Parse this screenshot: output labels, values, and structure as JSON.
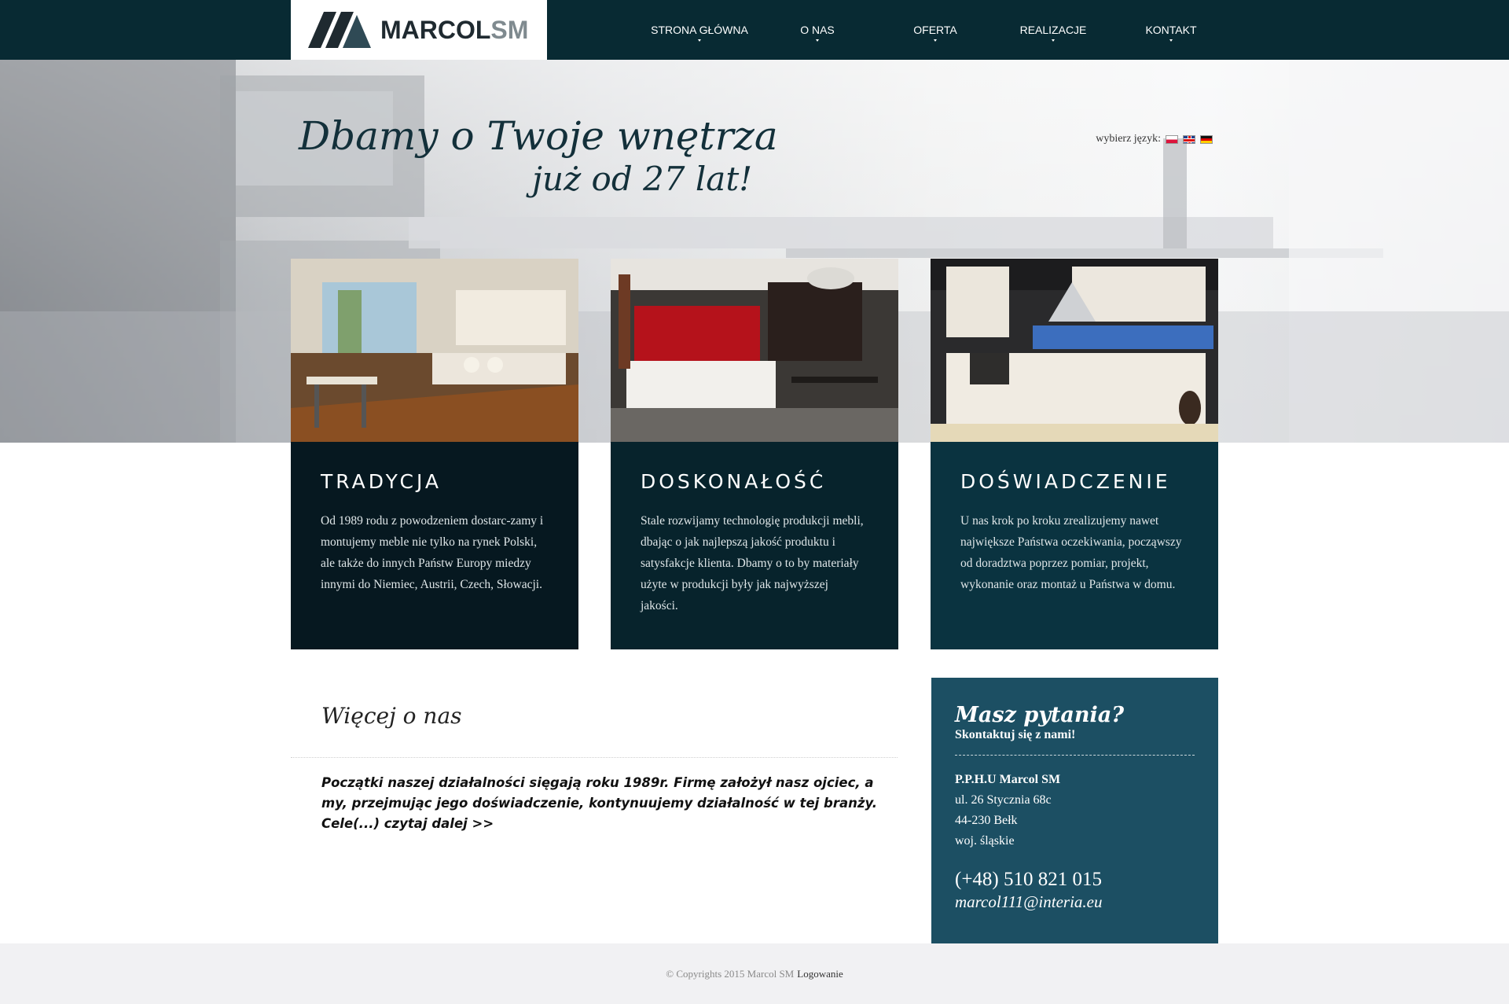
{
  "header": {
    "logo_main": "MARCOL",
    "logo_accent": "SM",
    "nav": [
      {
        "label": "STRONA GŁÓWNA"
      },
      {
        "label": "O NAS"
      },
      {
        "label": "OFERTA"
      },
      {
        "label": "REALIZACJE"
      },
      {
        "label": "KONTAKT"
      }
    ]
  },
  "language": {
    "label": "wybierz język:",
    "options": [
      {
        "icon": "flag-pl-icon"
      },
      {
        "icon": "flag-en-icon"
      },
      {
        "icon": "flag-de-icon"
      }
    ]
  },
  "hero": {
    "title": "Dbamy o Twoje wnętrza",
    "subtitle": "już od 27 lat!"
  },
  "cards": [
    {
      "title": "TRADYCJA",
      "text": "Od 1989 rodu z powodzeniem dostarc-zamy i montujemy meble nie tylko na rynek Polski, ale także do innych Państw Europy miedzy innymi do Niemiec, Austrii, Czech, Słowacji."
    },
    {
      "title": "DOSKONAŁOŚĆ",
      "text": "Stale rozwijamy technologię produkcji mebli, dbając o jak najlepszą jakość produktu i satysfakcje klienta. Dbamy o to by materiały użyte w produkcji były jak najwyższej jakości."
    },
    {
      "title": "DOŚWIADCZENIE",
      "text": "U nas krok po kroku zrealizujemy nawet największe Państwa oczekiwania, począwszy od doradztwa poprzez pomiar, projekt, wykonanie oraz montaż u Państwa w domu."
    }
  ],
  "about": {
    "title": "Więcej o nas",
    "text": "Początki naszej działalności sięgają roku 1989r. Firmę założył nasz ojciec, a my, przejmując jego doświadczenie, kontynuujemy działalność w tej branży. Cele(...) czytaj dalej >>"
  },
  "contact": {
    "title": "Masz pytania?",
    "subtitle": "Skontaktuj się z nami!",
    "company": "P.P.H.U Marcol SM",
    "street": "ul. 26 Stycznia 68c",
    "city": "44-230 Bełk",
    "region": "woj. śląskie",
    "phone": "(+48) 510 821 015",
    "email": "marcol111@interia.eu"
  },
  "footer": {
    "copyright": "© Copyrights 2015 Marcol SM",
    "login": "Logowanie"
  },
  "colors": {
    "header_bg": "#082a33",
    "card1_bg": "#061820",
    "card2_bg": "#07232c",
    "card3_bg": "#0a3340",
    "contact_bg": "#1c4f63",
    "footer_bg": "#f1f1f3"
  }
}
